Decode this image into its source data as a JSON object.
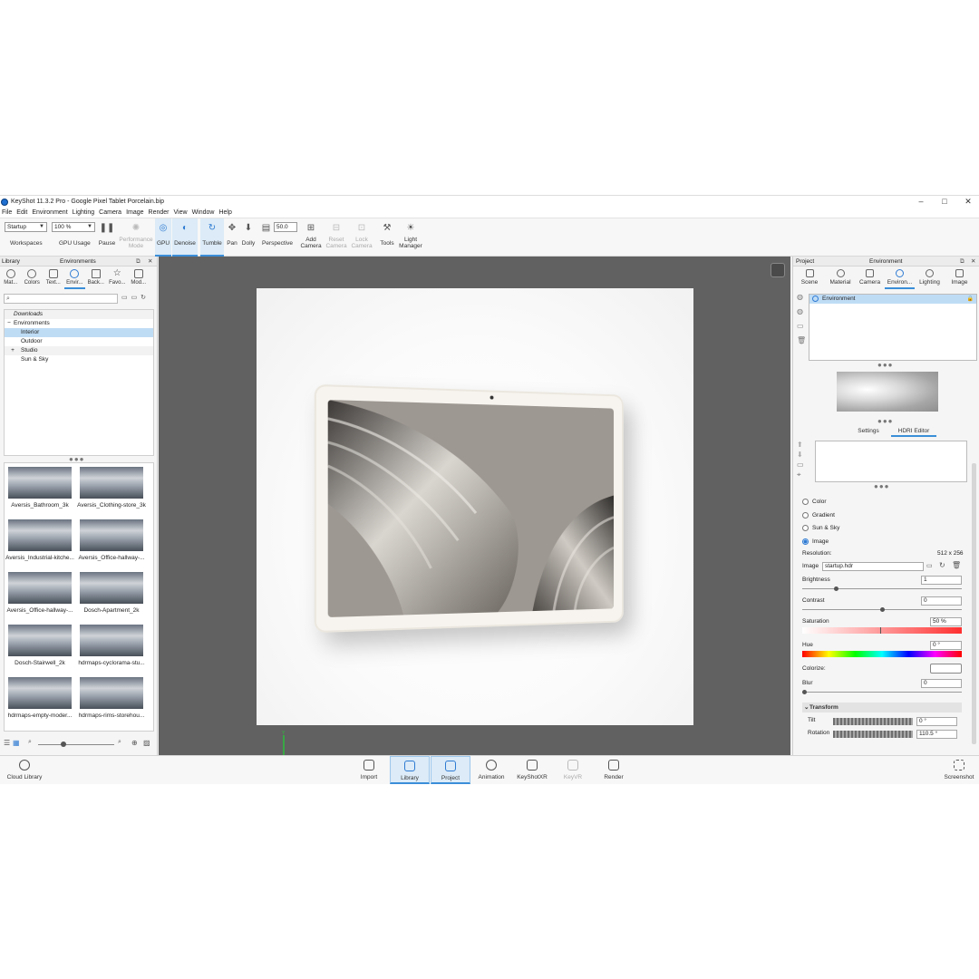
{
  "window": {
    "title": "KeyShot 11.3.2 Pro  - Google Pixel Tablet Porcelain.bip",
    "minimize": "–",
    "maximize": "□",
    "close": "✕"
  },
  "menu": [
    "File",
    "Edit",
    "Environment",
    "Lighting",
    "Camera",
    "Image",
    "Render",
    "View",
    "Window",
    "Help"
  ],
  "toolbar": {
    "workspace_value": "Startup",
    "workspace_label": "Workspaces",
    "gpu_usage_value": "100 %",
    "gpu_usage_label": "GPU Usage",
    "pause_label": "Pause",
    "performance_mode_label": "Performance Mode",
    "gpu_label": "GPU",
    "denoise_label": "Denoise",
    "tumble_label": "Tumble",
    "pan_label": "Pan",
    "dolly_label": "Dolly",
    "perspective_value": "50.0",
    "perspective_label": "Perspective",
    "add_camera_label": "Add Camera",
    "reset_camera_label": "Reset Camera",
    "lock_camera_label": "Lock Camera",
    "tools_label": "Tools",
    "light_manager_label": "Light Manager"
  },
  "library": {
    "panel_title": "Library",
    "panel_subtitle": "Environments",
    "tabs": [
      "Mat...",
      "Colors",
      "Text...",
      "Envir...",
      "Back...",
      "Favo...",
      "Mod..."
    ],
    "active_tab": 3,
    "search_placeholder": "",
    "tree": [
      {
        "label": "Downloads",
        "prefix": "",
        "italic": true
      },
      {
        "label": "Environments",
        "prefix": "−",
        "italic": false
      },
      {
        "label": "Interior",
        "prefix": "",
        "italic": false,
        "selected": true
      },
      {
        "label": "Outdoor",
        "prefix": "",
        "italic": false
      },
      {
        "label": "Studio",
        "prefix": "+",
        "italic": false
      },
      {
        "label": "Sun & Sky",
        "prefix": "",
        "italic": false
      }
    ],
    "thumbnails": [
      "Aversis_Bathroom_3k",
      "Aversis_Clothing-store_3k",
      "Aversis_Industrial-kitche...",
      "Aversis_Office-hallway-...",
      "Aversis_Office-hallway-...",
      "Dosch-Apartment_2k",
      "Dosch-Stairwell_2k",
      "hdrmaps-cyclorama-stu...",
      "hdrmaps-empty-moder...",
      "hdrmaps-rims-storehou..."
    ],
    "cloud_library_label": "Cloud Library"
  },
  "project": {
    "panel_title": "Project",
    "panel_subtitle": "Environment",
    "tabs": [
      "Scene",
      "Material",
      "Camera",
      "Environ...",
      "Lighting",
      "Image"
    ],
    "active_tab": 3,
    "environment_item": "Environment",
    "sub_tabs": [
      "Settings",
      "HDRI Editor"
    ],
    "active_sub_tab": 1,
    "background_options": [
      "Color",
      "Gradient",
      "Sun & Sky",
      "Image"
    ],
    "selected_option": "Image",
    "resolution_label": "Resolution:",
    "resolution_value": "512 x 256",
    "image_label": "Image",
    "image_value": "startup.hdr",
    "brightness_label": "Brightness",
    "brightness_value": "1",
    "contrast_label": "Contrast",
    "contrast_value": "0",
    "saturation_label": "Saturation",
    "saturation_value": "50 %",
    "hue_label": "Hue",
    "hue_value": "0 °",
    "colorize_label": "Colorize:",
    "blur_label": "Blur",
    "blur_value": "0",
    "transform_label": "Transform",
    "tilt_label": "Tilt",
    "tilt_value": "0 °",
    "rotation_label": "Rotation",
    "rotation_value": "110.5 °"
  },
  "bottom_bar": {
    "import": "Import",
    "library": "Library",
    "project": "Project",
    "animation": "Animation",
    "keyshotxr": "KeyShotXR",
    "keyvr": "KeyVR",
    "render": "Render",
    "screenshot": "Screenshot"
  },
  "colors": {
    "accent": "#3a8ed8",
    "selection": "#bfdcf5",
    "viewport_bg": "#616161"
  }
}
